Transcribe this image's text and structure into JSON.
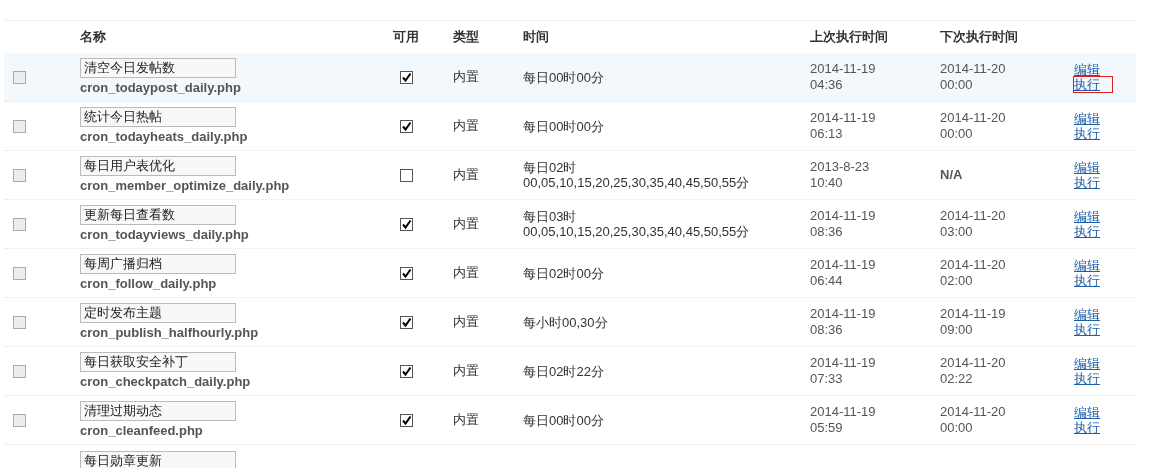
{
  "table": {
    "columns": [
      "名称",
      "可用",
      "类型",
      "时间",
      "上次执行时间",
      "下次执行时间"
    ],
    "rows": [
      {
        "selected": false,
        "hover": true,
        "title": "清空今日发帖数",
        "file": "cron_todaypost_daily.php",
        "enabled": true,
        "type": "内置",
        "time": "每日00时00分",
        "last": [
          "2014-11-19",
          "04:36"
        ],
        "next": [
          "2014-11-20",
          "00:00"
        ],
        "actions": [
          {
            "label": "编辑",
            "marked": false
          },
          {
            "label": "执行",
            "marked": true
          }
        ]
      },
      {
        "selected": false,
        "hover": false,
        "title": "统计今日热帖",
        "file": "cron_todayheats_daily.php",
        "enabled": true,
        "type": "内置",
        "time": "每日00时00分",
        "last": [
          "2014-11-19",
          "06:13"
        ],
        "next": [
          "2014-11-20",
          "00:00"
        ],
        "actions": [
          {
            "label": "编辑",
            "marked": false
          },
          {
            "label": "执行",
            "marked": false
          }
        ]
      },
      {
        "selected": false,
        "hover": false,
        "title": "每日用户表优化",
        "file": "cron_member_optimize_daily.php",
        "enabled": false,
        "type": "内置",
        "time": "每日02时",
        "time_detail": "00,05,10,15,20,25,30,35,40,45,50,55分",
        "last": [
          "2013-8-23",
          "10:40"
        ],
        "next": [
          "N/A"
        ],
        "actions": [
          {
            "label": "编辑",
            "marked": false
          },
          {
            "label": "执行",
            "marked": false
          }
        ]
      },
      {
        "selected": false,
        "hover": false,
        "title": "更新每日查看数",
        "file": "cron_todayviews_daily.php",
        "enabled": true,
        "type": "内置",
        "time": "每日03时",
        "time_detail": "00,05,10,15,20,25,30,35,40,45,50,55分",
        "last": [
          "2014-11-19",
          "08:36"
        ],
        "next": [
          "2014-11-20",
          "03:00"
        ],
        "actions": [
          {
            "label": "编辑",
            "marked": false
          },
          {
            "label": "执行",
            "marked": false
          }
        ]
      },
      {
        "selected": false,
        "hover": false,
        "title": "每周广播归档",
        "file": "cron_follow_daily.php",
        "enabled": true,
        "type": "内置",
        "time": "每日02时00分",
        "last": [
          "2014-11-19",
          "06:44"
        ],
        "next": [
          "2014-11-20",
          "02:00"
        ],
        "actions": [
          {
            "label": "编辑",
            "marked": false
          },
          {
            "label": "执行",
            "marked": false
          }
        ]
      },
      {
        "selected": false,
        "hover": false,
        "title": "定时发布主题",
        "file": "cron_publish_halfhourly.php",
        "enabled": true,
        "type": "内置",
        "time": "每小时00,30分",
        "last": [
          "2014-11-19",
          "08:36"
        ],
        "next": [
          "2014-11-19",
          "09:00"
        ],
        "actions": [
          {
            "label": "编辑",
            "marked": false
          },
          {
            "label": "执行",
            "marked": false
          }
        ]
      },
      {
        "selected": false,
        "hover": false,
        "title": "每日获取安全补丁",
        "file": "cron_checkpatch_daily.php",
        "enabled": true,
        "type": "内置",
        "time": "每日02时22分",
        "last": [
          "2014-11-19",
          "07:33"
        ],
        "next": [
          "2014-11-20",
          "02:22"
        ],
        "actions": [
          {
            "label": "编辑",
            "marked": false
          },
          {
            "label": "执行",
            "marked": false
          }
        ]
      },
      {
        "selected": false,
        "hover": false,
        "title": "清理过期动态",
        "file": "cron_cleanfeed.php",
        "enabled": true,
        "type": "内置",
        "time": "每日00时00分",
        "last": [
          "2014-11-19",
          "05:59"
        ],
        "next": [
          "2014-11-20",
          "00:00"
        ],
        "actions": [
          {
            "label": "编辑",
            "marked": false
          },
          {
            "label": "执行",
            "marked": false
          }
        ]
      }
    ],
    "partial_row": {
      "title": "每日勋章更新"
    }
  }
}
